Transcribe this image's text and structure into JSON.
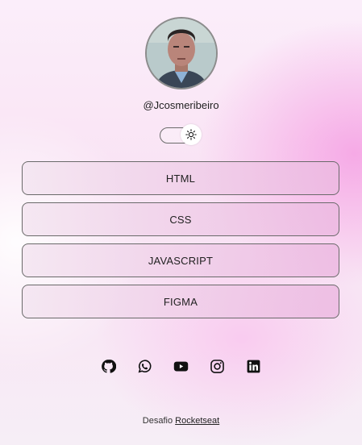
{
  "profile": {
    "handle": "@Jcosmeribeiro",
    "avatar_icon": "user-photo"
  },
  "theme_toggle": {
    "icon": "sun-icon",
    "state": "light"
  },
  "links": [
    {
      "label": "HTML"
    },
    {
      "label": "CSS"
    },
    {
      "label": "JAVASCRIPT"
    },
    {
      "label": "FIGMA"
    }
  ],
  "socials": [
    {
      "icon": "github-icon"
    },
    {
      "icon": "whatsapp-icon"
    },
    {
      "icon": "youtube-icon"
    },
    {
      "icon": "instagram-icon"
    },
    {
      "icon": "linkedin-icon"
    }
  ],
  "footer": {
    "prefix": "Desafio",
    "link_label": "Rocketseat"
  },
  "colors": {
    "accent_pink": "#f596e1",
    "border": "#6a6a6a",
    "text": "#1a1a1a"
  }
}
